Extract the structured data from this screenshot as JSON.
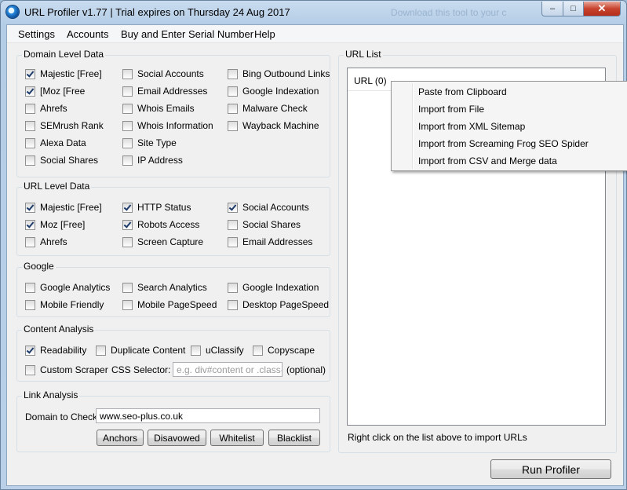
{
  "window": {
    "title": "URL Profiler v1.77 | Trial expires on Thursday 24 Aug 2017",
    "ghost_text": "Download this tool to your c"
  },
  "menu": [
    "Settings",
    "Accounts",
    "Buy and Enter Serial Number",
    "Help"
  ],
  "domain_level": {
    "legend": "Domain Level Data",
    "items": [
      {
        "label": "Majestic [Free]",
        "checked": true
      },
      {
        "label": "[Moz [Free",
        "checked": true
      },
      {
        "label": "Ahrefs",
        "checked": false
      },
      {
        "label": "SEMrush Rank",
        "checked": false
      },
      {
        "label": "Alexa Data",
        "checked": false
      },
      {
        "label": "Social Shares",
        "checked": false
      },
      {
        "label": "Social Accounts",
        "checked": false
      },
      {
        "label": "Email Addresses",
        "checked": false
      },
      {
        "label": "Whois Emails",
        "checked": false
      },
      {
        "label": "Whois Information",
        "checked": false
      },
      {
        "label": "Site Type",
        "checked": false
      },
      {
        "label": "IP Address",
        "checked": false
      },
      {
        "label": "Bing Outbound Links",
        "checked": false
      },
      {
        "label": "Google Indexation",
        "checked": false
      },
      {
        "label": "Malware Check",
        "checked": false
      },
      {
        "label": "Wayback Machine",
        "checked": false
      }
    ]
  },
  "url_level": {
    "legend": "URL Level Data",
    "items": [
      {
        "label": "Majestic [Free]",
        "checked": true
      },
      {
        "label": "Moz [Free]",
        "checked": true
      },
      {
        "label": "Ahrefs",
        "checked": false
      },
      {
        "label": "HTTP Status",
        "checked": true
      },
      {
        "label": "Robots Access",
        "checked": true
      },
      {
        "label": "Screen Capture",
        "checked": false
      },
      {
        "label": "Social Accounts",
        "checked": true
      },
      {
        "label": "Social Shares",
        "checked": false
      },
      {
        "label": "Email Addresses",
        "checked": false
      }
    ]
  },
  "google": {
    "legend": "Google",
    "items": [
      {
        "label": "Google Analytics",
        "checked": false
      },
      {
        "label": "Mobile Friendly",
        "checked": false
      },
      {
        "label": "Search Analytics",
        "checked": false
      },
      {
        "label": "Mobile PageSpeed",
        "checked": false
      },
      {
        "label": "Google Indexation",
        "checked": false
      },
      {
        "label": "Desktop PageSpeed",
        "checked": false
      }
    ]
  },
  "content": {
    "legend": "Content Analysis",
    "items": [
      {
        "label": "Readability",
        "checked": true
      },
      {
        "label": "Duplicate Content",
        "checked": false
      },
      {
        "label": "uClassify",
        "checked": false
      },
      {
        "label": "Copyscape",
        "checked": false
      },
      {
        "label": "Custom Scraper",
        "checked": false
      }
    ],
    "css_selector_label": "CSS Selector:",
    "css_selector_placeholder": "e.g. div#content or .class-na",
    "optional_label": "(optional)"
  },
  "link": {
    "legend": "Link Analysis",
    "domain_label": "Domain to Check:",
    "domain_value": "www.seo-plus.co.uk",
    "buttons": [
      "Anchors",
      "Disavowed",
      "Whitelist",
      "Blacklist"
    ]
  },
  "url_list": {
    "legend": "URL List",
    "header": "URL (0)",
    "hint": "Right click on the list above to import URLs"
  },
  "context_menu": [
    "Paste from Clipboard",
    "Import from File",
    "Import from XML Sitemap",
    "Import from Screaming Frog SEO Spider",
    "Import from CSV and Merge data"
  ],
  "run_button": "Run Profiler"
}
